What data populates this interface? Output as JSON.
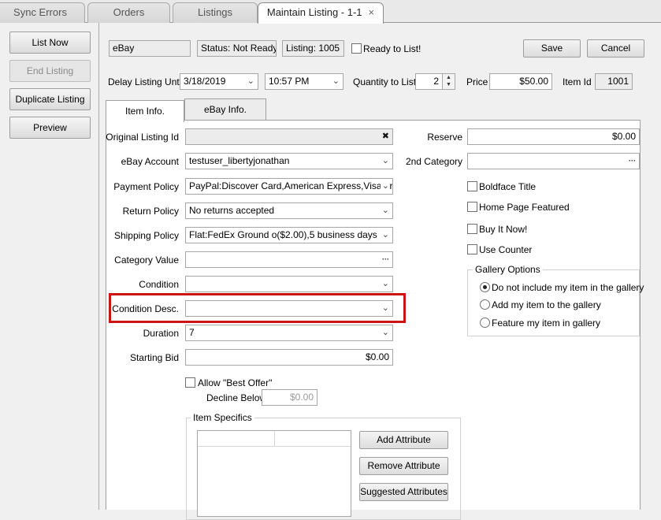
{
  "tabs": [
    {
      "label": "Sync Errors"
    },
    {
      "label": "Orders"
    },
    {
      "label": "Listings"
    },
    {
      "label": "Maintain Listing - 1-1",
      "close": "×"
    }
  ],
  "left_actions": {
    "list_now": "List Now",
    "end_listing": "End Listing",
    "duplicate_listing": "Duplicate Listing",
    "preview": "Preview"
  },
  "header": {
    "channel": "eBay",
    "status": "Status: Not Ready",
    "listing": "Listing: 1005",
    "ready_to_list_label": "Ready to List!",
    "ready_to_list_checked": false,
    "save": "Save",
    "cancel": "Cancel"
  },
  "row2": {
    "delay_label": "Delay Listing Until",
    "delay_date": "3/18/2019",
    "delay_time": "10:57 PM",
    "qty_label": "Quantity to List",
    "qty_value": "2",
    "price_label": "Price",
    "price_value": "$50.00",
    "item_id_label": "Item Id",
    "item_id_value": "1001"
  },
  "inner_tabs": [
    "Item Info.",
    "eBay Info."
  ],
  "form": {
    "original_listing_id": {
      "label": "Original Listing Id",
      "value": ""
    },
    "ebay_account": {
      "label": "eBay Account",
      "value": "testuser_libertyjonathan"
    },
    "payment_policy": {
      "label": "Payment Policy",
      "value": "PayPal:Discover Card,American Express,Visa or"
    },
    "return_policy": {
      "label": "Return Policy",
      "value": "No returns accepted"
    },
    "shipping_policy": {
      "label": "Shipping Policy",
      "value": "Flat:FedEx Ground o($2.00),5 business days"
    },
    "category_value": {
      "label": "Category Value",
      "value": ""
    },
    "condition": {
      "label": "Condition",
      "value": ""
    },
    "condition_desc": {
      "label": "Condition Desc.",
      "value": ""
    },
    "duration": {
      "label": "Duration",
      "value": "7"
    },
    "starting_bid": {
      "label": "Starting Bid",
      "value": "$0.00"
    },
    "allow_best_offer": {
      "label": "Allow \"Best Offer\"",
      "checked": false
    },
    "decline_below": {
      "label": "Decline Below",
      "value": "$0.00"
    }
  },
  "item_specifics": {
    "title": "Item Specifics",
    "add": "Add Attribute",
    "remove": "Remove Attribute",
    "suggested": "Suggested Attributes"
  },
  "right": {
    "reserve_label": "Reserve",
    "reserve_value": "$0.00",
    "second_category_label": "2nd Category",
    "second_category_value": "",
    "boldface": "Boldface Title",
    "home_page": "Home Page Featured",
    "buy_it_now": "Buy It Now!",
    "use_counter": "Use Counter",
    "gallery_title": "Gallery Options",
    "gallery_options": [
      {
        "label": "Do not include my item in the gallery",
        "selected": true
      },
      {
        "label": "Add my item to the gallery",
        "selected": false
      },
      {
        "label": "Feature my item in gallery",
        "selected": false
      }
    ]
  },
  "glyphs": {
    "clear": "✖",
    "ellipsis": "···",
    "dropdown": "⌄",
    "up": "▲",
    "down": "▼"
  },
  "colors": {
    "highlight": "#cc1414"
  }
}
